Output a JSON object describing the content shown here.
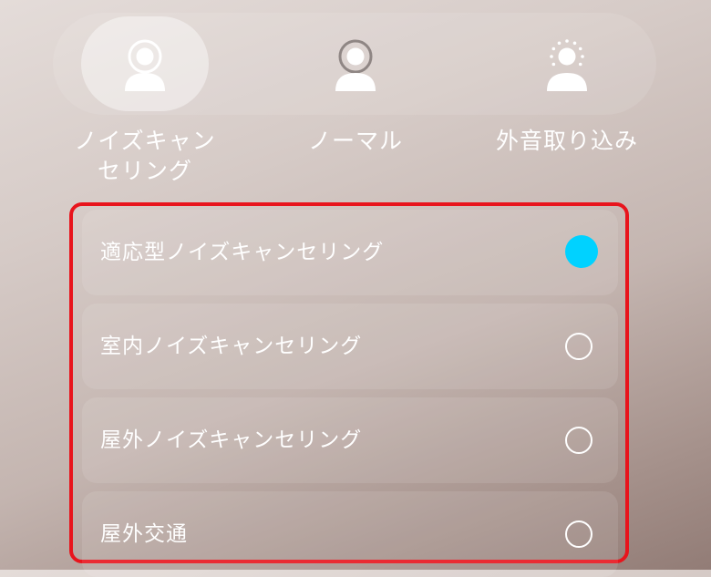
{
  "modes": [
    {
      "label": "ノイズキャン\nセリング",
      "icon": "noise-cancel-person-icon",
      "selected": true
    },
    {
      "label": "ノーマル",
      "icon": "normal-person-icon",
      "selected": false
    },
    {
      "label": "外音取り込み",
      "icon": "ambient-person-icon",
      "selected": false
    }
  ],
  "options": [
    {
      "label": "適応型ノイズキャンセリング",
      "selected": true
    },
    {
      "label": "室内ノイズキャンセリング",
      "selected": false
    },
    {
      "label": "屋外ノイズキャンセリング",
      "selected": false
    },
    {
      "label": "屋外交通",
      "selected": false
    }
  ],
  "colors": {
    "accent": "#00d2ff",
    "highlight_border": "#e8141c",
    "text": "#ffffff"
  }
}
